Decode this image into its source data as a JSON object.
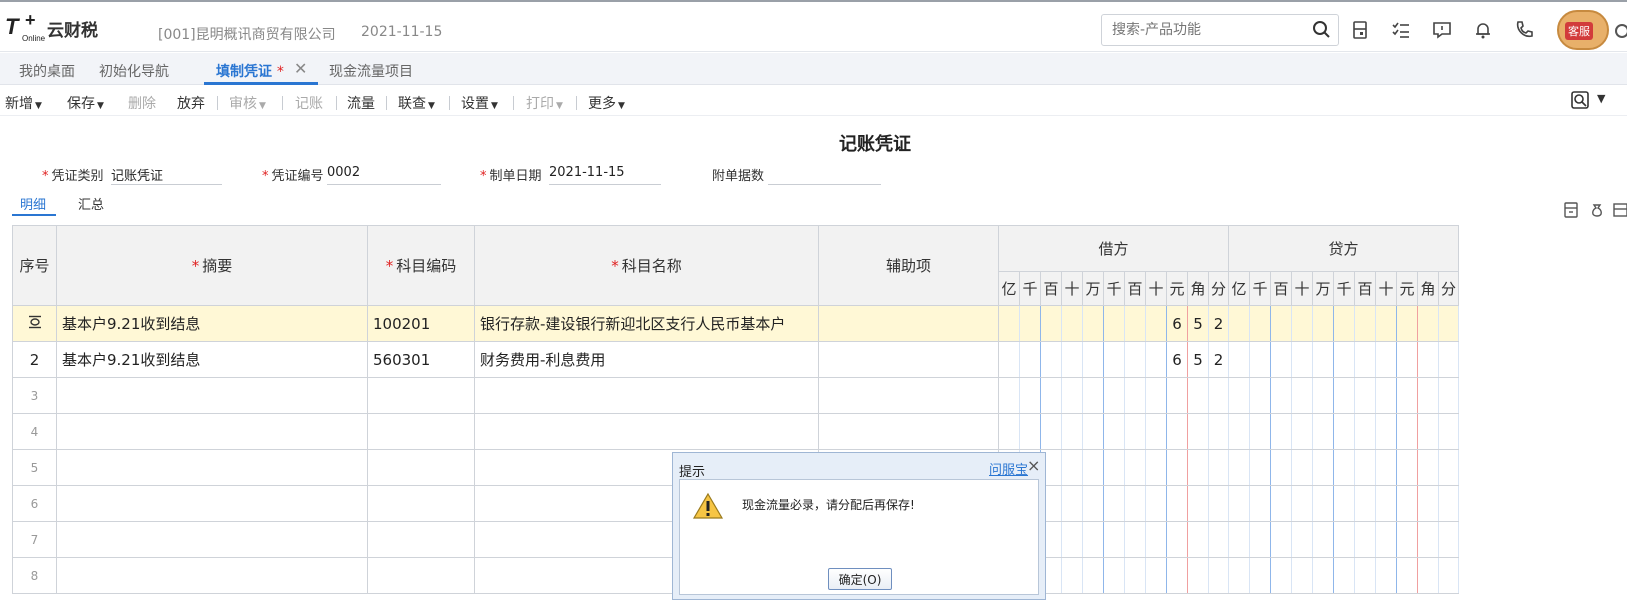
{
  "header": {
    "logo_name": "云财税",
    "logo_online": "Online",
    "company": "[001]昆明概讯商贸有限公司",
    "date": "2021-11-15",
    "search_placeholder": "搜索-产品功能",
    "service_badge": "客服"
  },
  "tabs": [
    {
      "label": "我的桌面"
    },
    {
      "label": "初始化导航"
    },
    {
      "label": "填制凭证",
      "modified_mark": "*"
    },
    {
      "label": "现金流量项目"
    }
  ],
  "toolbar": {
    "items": [
      "新增",
      "保存",
      "删除",
      "放弃",
      "审核",
      "记账",
      "流量",
      "联查",
      "设置",
      "打印",
      "更多"
    ]
  },
  "voucher": {
    "title": "记账凭证",
    "fields": {
      "type_label": "凭证类别",
      "type_value": "记账凭证",
      "number_label": "凭证编号",
      "number_value": "0002",
      "date_label": "制单日期",
      "date_value": "2021-11-15",
      "attachments_label": "附单据数",
      "attachments_value": ""
    },
    "subtabs": [
      "明细",
      "汇总"
    ]
  },
  "grid": {
    "headers": {
      "seq": "序号",
      "summary": "摘要",
      "account_code": "科目编码",
      "account_name": "科目名称",
      "auxiliary": "辅助项",
      "debit": "借方",
      "credit": "贷方"
    },
    "digit_units": [
      "亿",
      "千",
      "百",
      "十",
      "万",
      "千",
      "百",
      "十",
      "元",
      "角",
      "分"
    ],
    "rows": [
      {
        "seq": "",
        "summary": "基本户9.21收到结息",
        "code": "100201",
        "name": "银行存款-建设银行新迎北区支行人民币基本户",
        "aux": "",
        "debit_digits": [
          "",
          "",
          "",
          "",
          "",
          "",
          "",
          "",
          "6",
          "5",
          "2"
        ],
        "credit_digits": [
          "",
          "",
          "",
          "",
          "",
          "",
          "",
          "",
          "",
          "",
          ""
        ]
      },
      {
        "seq": "2",
        "summary": "基本户9.21收到结息",
        "code": "560301",
        "name": "财务费用-利息费用",
        "aux": "",
        "debit_digits": [
          "",
          "",
          "",
          "",
          "",
          "",
          "",
          "",
          "6",
          "5",
          "2"
        ],
        "credit_digits": [
          "",
          "",
          "",
          "",
          "",
          "",
          "",
          "",
          "",
          "",
          ""
        ]
      },
      {
        "seq": "3",
        "summary": "",
        "code": "",
        "name": "",
        "aux": "",
        "debit_digits": [
          "",
          "",
          "",
          "",
          "",
          "",
          "",
          "",
          "",
          "",
          ""
        ],
        "credit_digits": [
          "",
          "",
          "",
          "",
          "",
          "",
          "",
          "",
          "",
          "",
          ""
        ]
      },
      {
        "seq": "4",
        "summary": "",
        "code": "",
        "name": "",
        "aux": "",
        "debit_digits": [
          "",
          "",
          "",
          "",
          "",
          "",
          "",
          "",
          "",
          "",
          ""
        ],
        "credit_digits": [
          "",
          "",
          "",
          "",
          "",
          "",
          "",
          "",
          "",
          "",
          ""
        ]
      },
      {
        "seq": "5",
        "summary": "",
        "code": "",
        "name": "",
        "aux": "",
        "debit_digits": [
          "",
          "",
          "",
          "",
          "",
          "",
          "",
          "",
          "",
          "",
          ""
        ],
        "credit_digits": [
          "",
          "",
          "",
          "",
          "",
          "",
          "",
          "",
          "",
          "",
          ""
        ]
      },
      {
        "seq": "6",
        "summary": "",
        "code": "",
        "name": "",
        "aux": "",
        "debit_digits": [
          "",
          "",
          "",
          "",
          "",
          "",
          "",
          "",
          "",
          "",
          ""
        ],
        "credit_digits": [
          "",
          "",
          "",
          "",
          "",
          "",
          "",
          "",
          "",
          "",
          ""
        ]
      },
      {
        "seq": "7",
        "summary": "",
        "code": "",
        "name": "",
        "aux": "",
        "debit_digits": [
          "",
          "",
          "",
          "",
          "",
          "",
          "",
          "",
          "",
          "",
          ""
        ],
        "credit_digits": [
          "",
          "",
          "",
          "",
          "",
          "",
          "",
          "",
          "",
          "",
          ""
        ]
      },
      {
        "seq": "8",
        "summary": "",
        "code": "",
        "name": "",
        "aux": "",
        "debit_digits": [
          "",
          "",
          "",
          "",
          "",
          "",
          "",
          "",
          "",
          "",
          ""
        ],
        "credit_digits": [
          "",
          "",
          "",
          "",
          "",
          "",
          "",
          "",
          "",
          "",
          ""
        ]
      }
    ]
  },
  "dialog": {
    "title": "提示",
    "help_link": "问服宝",
    "close": "×",
    "message": "现金流量必录，请分配后再保存!",
    "ok_label": "确定(O)"
  },
  "colors": {
    "accent": "#2a76d2",
    "required": "#e02020",
    "selected_row": "#fff8d6"
  }
}
